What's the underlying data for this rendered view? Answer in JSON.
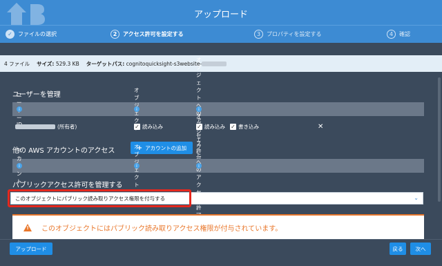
{
  "header": {
    "title": "アップロード"
  },
  "steps": [
    {
      "num": "✓",
      "label": "ファイルの選択"
    },
    {
      "num": "2",
      "label": "アクセス許可を設定する"
    },
    {
      "num": "3",
      "label": "プロパティを設定する"
    },
    {
      "num": "4",
      "label": "確認"
    }
  ],
  "infobar": {
    "files": "4 ファイル",
    "size_label": "サイズ:",
    "size_value": "529.3 KB",
    "target_label": "ターゲットパス:",
    "target_value": "cognitoquicksight-s3website-"
  },
  "manage_users": {
    "title": "ユーザーを管理",
    "col_user_id": "ユーザー ID",
    "col_object": "オブジェクト",
    "col_object_access": "オブジェクトへのアクセス許可",
    "row_owner_suffix": "(所有者)",
    "read": "読み込み",
    "read2": "読み込み",
    "write": "書き込み",
    "remove": "✕"
  },
  "other_accounts": {
    "title": "他の AWS アカウントのアクセス",
    "add_button": "アカウントの追加",
    "col_account": "アカウント",
    "col_object": "オブジェクト",
    "col_object_access": "オブジェクトへのアクセス許可"
  },
  "public_access": {
    "title": "パブリックアクセス許可を管理する",
    "select_value": "このオブジェクトにパブリック読み取りアクセス権限を付与する",
    "warning": "このオブジェクトにはパブリック読み取りアクセス権限が付与されています。"
  },
  "footer": {
    "upload": "アップロード",
    "back": "戻る",
    "next": "次へ"
  },
  "colors": {
    "accent": "#3d8bd3",
    "button": "#1f8ee6",
    "warning": "#e9772b",
    "highlight": "#e5281e"
  }
}
